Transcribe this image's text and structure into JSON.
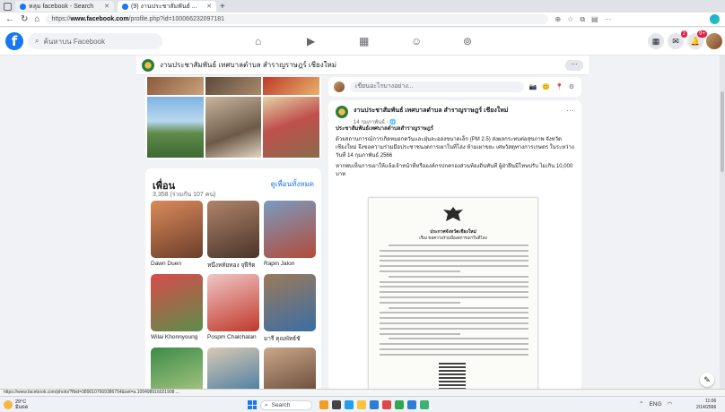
{
  "browser": {
    "tabs": [
      {
        "label": "หลุม facebook - Search",
        "active": false
      },
      {
        "label": "(9) งานประชาสัมพันธ์ ...",
        "active": true
      }
    ],
    "url_prefix": "https://",
    "url_host": "www.facebook.com",
    "url_path": "/profile.php?id=100066232097181"
  },
  "fb": {
    "search_placeholder": "ค้นหาบน Facebook",
    "notif_badge": "9+",
    "msg_badge": "2"
  },
  "profile": {
    "page_name": "งานประชาสัมพันธ์ เทศบาลตำบล สำราญราษฎร์ เชียงใหม่",
    "more_label": "···"
  },
  "friends": {
    "title": "เพื่อน",
    "see_all": "ดูเพื่อนทั้งหมด",
    "count": "3,358 (ร่วมกัน 107 คน)",
    "items": [
      {
        "name": "Dawn Duen",
        "c1": "#d98b5b",
        "c2": "#6d3d2a"
      },
      {
        "name": "หนึ่งหทัยทอง จุฬีรัต",
        "c1": "#b0836b",
        "c2": "#4a3428"
      },
      {
        "name": "Rapin Jalon",
        "c1": "#7a9bbf",
        "c2": "#b24b3a"
      },
      {
        "name": "Wilai Khonnyoung",
        "c1": "#d94b4b",
        "c2": "#5b8e4a"
      },
      {
        "name": "Pospm Chalchalan",
        "c1": "#f0c6c6",
        "c2": "#c0392b"
      },
      {
        "name": "มารี คุณพัทธ์ชั",
        "c1": "#9c7a5a",
        "c2": "#3a6ea5"
      },
      {
        "name": "",
        "c1": "#3d8b4a",
        "c2": "#b8d08a"
      },
      {
        "name": "",
        "c1": "#d8c9b4",
        "c2": "#2f6f9e"
      },
      {
        "name": "",
        "c1": "#c9a78a",
        "c2": "#5a3a2a"
      }
    ]
  },
  "composer": {
    "placeholder": "เขียนอะไรบางอย่าง...",
    "tools": "📷 😊 📍 ⚙"
  },
  "post": {
    "page": "งานประชาสัมพันธ์ เทศบาลตำบล สำราญราษฎร์ เชียงใหม่",
    "time": "14 กุมภาพันธ์ · 🌐",
    "more": "···",
    "headline": "ประชาสัมพันธ์เทศบาลตำบลสำราญราษฎร์",
    "p1": "ด้วยสถานการณ์การเกิดหมอกควันและฝุ่นละอองขนาดเล็ก (PM 2.5) ส่งผลกระทบต่อสุขภาพ จังหวัดเชียงใหม่ จึงขอความร่วมมือประชาชนงดการเผาในที่โล่ง ห้ามเผาขยะ เศษวัสดุทางการเกษตร ในระหว่างวันที่ 14 กุมภาพันธ์ 2566",
    "p2": "หากพบเห็นการเผาให้แจ้งเจ้าหน้าที่หรือองค์กรปกครองส่วนท้องถิ่นทันที ผู้ฝ่าฝืนมีโทษปรับ ไม่เกิน 10,000 บาท",
    "doc_title": "ประกาศจังหวัดเชียงใหม่",
    "doc_subtitle": "เรื่อง ขอความร่วมมืองดการเผาในที่โล่ง"
  },
  "status_url": "https://www.facebook.com/photo/?fbid=3890107669386754&set=a.109498916021908 ...",
  "taskbar": {
    "temp": "29°C",
    "weather": "มีแดด",
    "search": "Search",
    "lang": "ENG",
    "time": "11:06",
    "date": "2/14/2566"
  },
  "colors": {
    "fb_blue": "#1877f2",
    "bg": "#f0f2f5",
    "badge_red": "#e41e3f"
  }
}
